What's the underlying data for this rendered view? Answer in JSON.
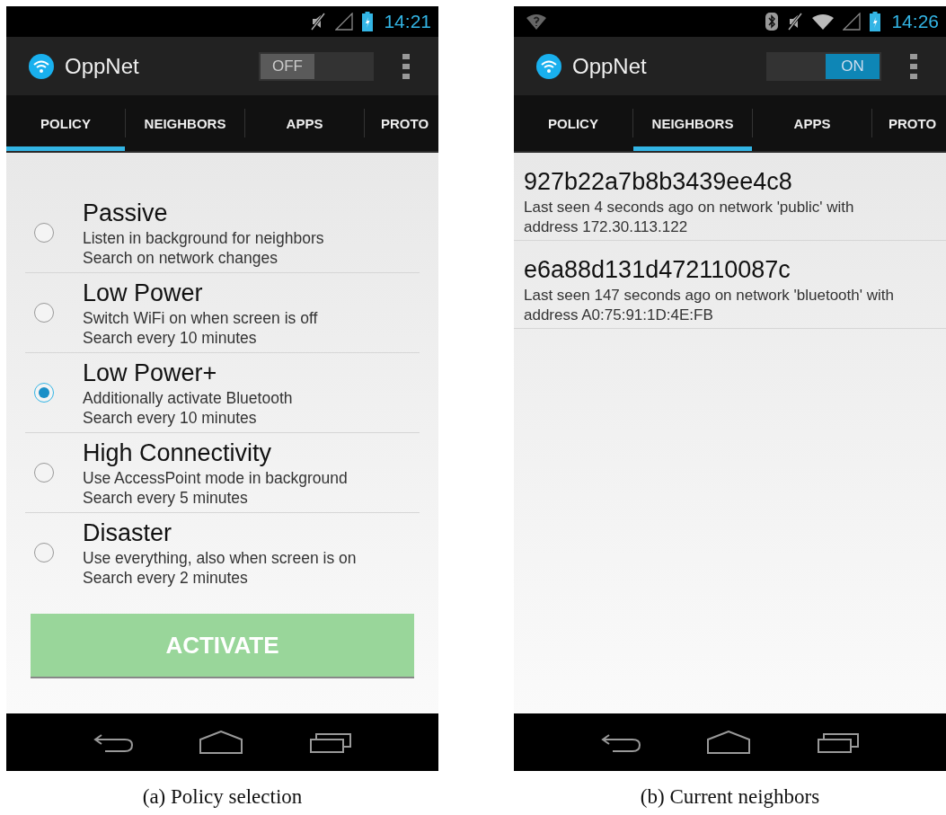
{
  "panels": [
    {
      "kind": "policy",
      "status": {
        "wifi_unknown": false,
        "bluetooth": false,
        "wifi": false,
        "time": "14:21"
      },
      "app_title": "OppNet",
      "switch": {
        "label": "OFF",
        "on": false
      },
      "tabs": [
        {
          "label": "POLICY",
          "selected": true
        },
        {
          "label": "NEIGHBORS",
          "selected": false
        },
        {
          "label": "APPS",
          "selected": false
        },
        {
          "label": "PROTO",
          "selected": false
        }
      ],
      "options": [
        {
          "title": "Passive",
          "lines": [
            "Listen in background for neighbors",
            "Search on network changes"
          ],
          "selected": false
        },
        {
          "title": "Low Power",
          "lines": [
            "Switch WiFi on when screen is off",
            "Search every 10 minutes"
          ],
          "selected": false
        },
        {
          "title": "Low Power+",
          "lines": [
            "Additionally activate Bluetooth",
            "Search every 10 minutes"
          ],
          "selected": true
        },
        {
          "title": "High Connectivity",
          "lines": [
            "Use AccessPoint mode in background",
            "Search every 5 minutes"
          ],
          "selected": false
        },
        {
          "title": "Disaster",
          "lines": [
            "Use everything, also when screen is on",
            "Search every 2 minutes"
          ],
          "selected": false
        }
      ],
      "button": {
        "label": "ACTIVATE",
        "disabled": true
      },
      "caption": "(a) Policy selection"
    },
    {
      "kind": "neighbors",
      "status": {
        "wifi_unknown": true,
        "bluetooth": true,
        "wifi": true,
        "time": "14:26"
      },
      "app_title": "OppNet",
      "switch": {
        "label": "ON",
        "on": true
      },
      "tabs": [
        {
          "label": "POLICY",
          "selected": false
        },
        {
          "label": "NEIGHBORS",
          "selected": true
        },
        {
          "label": "APPS",
          "selected": false
        },
        {
          "label": "PROTO",
          "selected": false
        }
      ],
      "neighbors": [
        {
          "id": "927b22a7b8b3439ee4c8",
          "lines": [
            "Last seen 4 seconds ago on network 'public' with",
            "address 172.30.113.122"
          ]
        },
        {
          "id": "e6a88d131d472110087c",
          "lines": [
            "Last seen 147 seconds ago on network 'bluetooth' with",
            "address A0:75:91:1D:4E:FB"
          ]
        }
      ],
      "caption": "(b) Current neighbors"
    }
  ]
}
